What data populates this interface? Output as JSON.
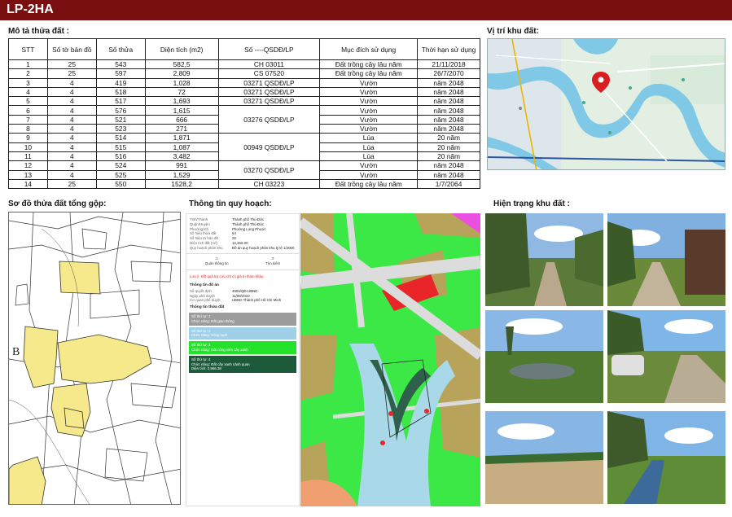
{
  "header": {
    "title": "LP-2HA"
  },
  "sections": {
    "parcel_desc": "Mô tả thửa đất :",
    "location": "Vị trí khu đất:",
    "cadastral": "Sơ đồ thửa đất tổng gộp:",
    "planning": "Thông tin quy hoạch:",
    "current": "Hiện trạng khu đất :"
  },
  "table": {
    "headers": [
      "STT",
      "Số tờ bản đồ",
      "Số thửa",
      "Diện tích (m2)",
      "Số ----QSDĐ/LP",
      "Mục đích sử dụng",
      "Thời hạn sử dụng"
    ],
    "rows": [
      [
        "1",
        "25",
        "543",
        "582,5",
        "CH 03011",
        "Đất trồng cây lâu năm",
        "21/11/2018"
      ],
      [
        "2",
        "25",
        "597",
        "2,809",
        "CS 07520",
        "Đất trồng cây lâu năm",
        "26/7/2070"
      ],
      [
        "3",
        "4",
        "419",
        "1,028",
        "03271 QSDĐ/LP",
        "Vườn",
        "năm 2048"
      ],
      [
        "4",
        "4",
        "518",
        "72",
        "03271 QSDĐ/LP",
        "Vườn",
        "năm 2048"
      ],
      [
        "5",
        "4",
        "517",
        "1,693",
        "03271 QSDĐ/LP",
        "Vườn",
        "năm 2048"
      ],
      [
        "6",
        "4",
        "576",
        "1,615",
        "",
        "Vườn",
        "năm 2048"
      ],
      [
        "7",
        "4",
        "521",
        "666",
        "03276 QSDĐ/LP",
        "Vườn",
        "năm 2048"
      ],
      [
        "8",
        "4",
        "523",
        "271",
        "",
        "Vườn",
        "năm 2048"
      ],
      [
        "9",
        "4",
        "514",
        "1,871",
        "",
        "Lúa",
        "20 năm"
      ],
      [
        "10",
        "4",
        "515",
        "1,087",
        "00949 QSDĐ/LP",
        "Lúa",
        "20 năm"
      ],
      [
        "11",
        "4",
        "516",
        "3,482",
        "",
        "Lúa",
        "20 năm"
      ],
      [
        "12",
        "4",
        "524",
        "991",
        "03270 QSDĐ/LP",
        "Vườn",
        "năm 2048"
      ],
      [
        "13",
        "4",
        "525",
        "1,529",
        "",
        "Vườn",
        "năm 2048"
      ],
      [
        "14",
        "25",
        "550",
        "1528,2",
        "CH 03223",
        "Đất trồng cây lâu năm",
        "1/7/2064"
      ]
    ]
  },
  "planning_panel": {
    "fields": [
      [
        "Tỉnh/Thành",
        "Thành phố Thủ Đức"
      ],
      [
        "Quận/Huyện",
        "Thành phố Thủ Đức"
      ],
      [
        "Phường/Xã",
        "Phường Long Phước"
      ],
      [
        "Số hiệu thửa đất",
        "64"
      ],
      [
        "Số hiệu tờ bản đồ",
        "25"
      ],
      [
        "Diện tích đất (m²)",
        "12,466.00"
      ],
      [
        "Quy hoạch phân khu",
        "Đồ án quy hoạch phân khu tỷ lệ 1/2000"
      ]
    ],
    "btn_left": "Quản thông tin",
    "btn_right": "Tìm kiếm",
    "note": "Lưu ý: Kết quả tra cứu chỉ có giá trị tham khảo.",
    "info_header": "Thông tin đồ án",
    "info_fields": [
      [
        "Số quyết định",
        "4606/QĐ-UBND"
      ],
      [
        "Ngày phê duyệt",
        "11/08/2010"
      ],
      [
        "Cơ quan phê duyệt",
        "UBND Thành phố Hồ Chí Minh"
      ]
    ],
    "land_header": "Thông tin thửa đất",
    "bars": [
      {
        "color": "#9c9c9c",
        "lines": [
          "Số thứ tự: 1",
          "Chức năng: Đất giao thông"
        ]
      },
      {
        "color": "#9fd0e8",
        "lines": [
          "Số thứ tự: 2",
          "Chức năng: Sông rạch"
        ]
      },
      {
        "color": "#22e22a",
        "lines": [
          "Số thứ tự: 3",
          "Chức năng: Đất công viên cây xanh"
        ]
      },
      {
        "color": "#1d5a3c",
        "lines": [
          "Số thứ tự: 4",
          "Chức năng: Đất cây xanh cảnh quan",
          "Diện tích: 2,966.38"
        ]
      }
    ]
  },
  "colors": {
    "title_bg": "#7a0f10",
    "plan_green": "#3be846",
    "plan_olive": "#b7a35a",
    "plan_red": "#e8262a",
    "plan_road": "#dcdcdc",
    "plan_water": "#a9d8e8",
    "plan_dark": "#2f6049"
  },
  "icons": {
    "location_marker": "map-pin-icon"
  }
}
